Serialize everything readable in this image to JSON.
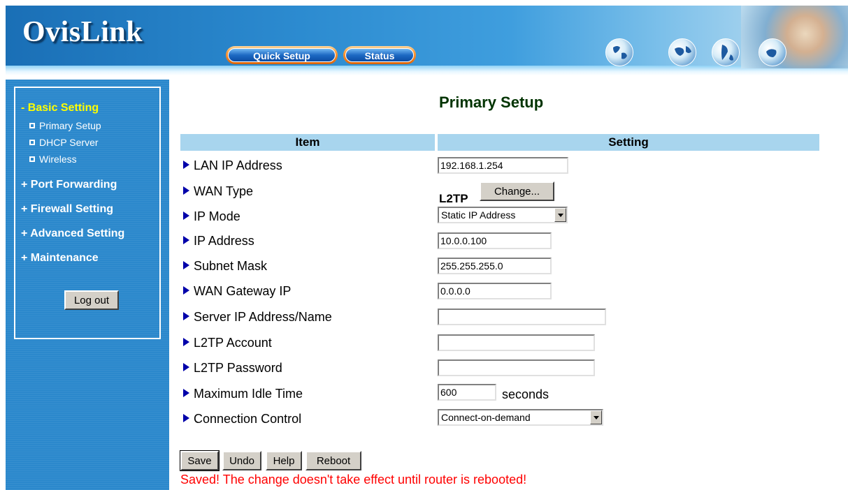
{
  "header": {
    "logo": "OvisLink",
    "nav": {
      "quick_setup": "Quick Setup",
      "status": "Status"
    }
  },
  "sidebar": {
    "sections": [
      {
        "label": "- Basic Setting",
        "active": true
      },
      {
        "label": "+ Port Forwarding"
      },
      {
        "label": "+ Firewall Setting"
      },
      {
        "label": "+ Advanced Setting"
      },
      {
        "label": "+ Maintenance"
      }
    ],
    "sub_items": [
      {
        "label": "Primary Setup"
      },
      {
        "label": "DHCP Server"
      },
      {
        "label": "Wireless"
      }
    ],
    "logout_label": "Log out"
  },
  "main": {
    "title": "Primary Setup",
    "table_headers": {
      "item": "Item",
      "setting": "Setting"
    },
    "rows": {
      "lan_ip": {
        "label": "LAN IP Address",
        "value": "192.168.1.254"
      },
      "wan_type": {
        "label": "WAN Type",
        "value": "L2TP",
        "button": "Change..."
      },
      "ip_mode": {
        "label": "IP Mode",
        "value": "Static IP Address"
      },
      "ip_address": {
        "label": "IP Address",
        "value": "10.0.0.100"
      },
      "subnet_mask": {
        "label": "Subnet Mask",
        "value": "255.255.255.0"
      },
      "wan_gateway": {
        "label": "WAN Gateway IP",
        "value": "0.0.0.0"
      },
      "server_ip": {
        "label": "Server IP Address/Name",
        "value": ""
      },
      "l2tp_account": {
        "label": "L2TP Account",
        "value": ""
      },
      "l2tp_password": {
        "label": "L2TP Password",
        "value": ""
      },
      "max_idle": {
        "label": "Maximum Idle Time",
        "value": "600",
        "unit": "seconds"
      },
      "conn_control": {
        "label": "Connection Control",
        "value": "Connect-on-demand"
      }
    },
    "buttons": {
      "save": "Save",
      "undo": "Undo",
      "help": "Help",
      "reboot": "Reboot"
    },
    "status_message": "Saved! The change doesn't take effect until router is rebooted!"
  },
  "colors": {
    "sidebar_bg": "#2b88cc",
    "active_menu": "#ffff00",
    "table_header_bg": "#a8d5ee",
    "title": "#003300",
    "status_message": "#ff0000",
    "row_arrow": "#0000aa"
  }
}
